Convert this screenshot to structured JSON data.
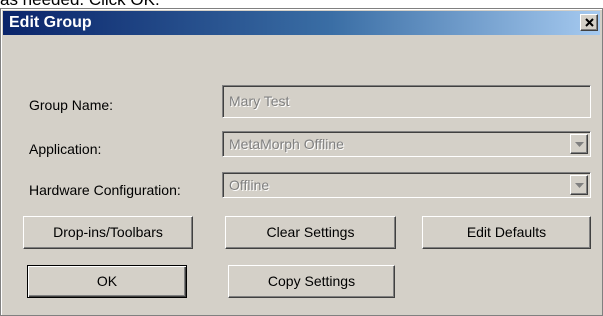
{
  "background": {
    "caption": "as needed.  Click OK."
  },
  "dialog": {
    "title": "Edit Group",
    "close_glyph": "×",
    "icons": {
      "close": "close-icon",
      "dropdown": "chevron-down-icon"
    },
    "fields": {
      "group_name": {
        "label": "Group Name:",
        "value": "Mary Test"
      },
      "application": {
        "label": "Application:",
        "value": "MetaMorph Offline"
      },
      "hardware": {
        "label": "Hardware Configuration:",
        "value": "Offline"
      }
    },
    "buttons": {
      "dropins": "Drop-ins/Toolbars",
      "clear": "Clear Settings",
      "defaults": "Edit Defaults",
      "ok": "OK",
      "copy": "Copy Settings"
    }
  },
  "colors": {
    "face": "#d4d0c8",
    "title_start": "#0a246a",
    "title_end": "#a6caf0",
    "disabled_text": "#808080"
  }
}
